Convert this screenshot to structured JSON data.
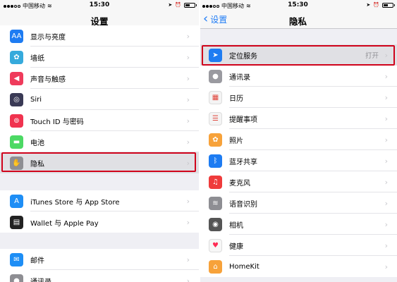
{
  "left": {
    "status": {
      "carrier": "中国移动",
      "time": "15:30"
    },
    "nav": {
      "title": "设置"
    },
    "group1": [
      {
        "label": "显示与亮度",
        "icon": "display-brightness-icon",
        "color": "#1e7cf2",
        "glyph": "AA"
      },
      {
        "label": "墙纸",
        "icon": "wallpaper-icon",
        "color": "#36aadc",
        "glyph": "✿"
      },
      {
        "label": "声音与触感",
        "icon": "sound-icon",
        "color": "#ef3b5b",
        "glyph": "◀"
      },
      {
        "label": "Siri",
        "icon": "siri-icon",
        "color": "#3a3a55",
        "glyph": "◎"
      },
      {
        "label": "Touch ID 与密码",
        "icon": "touch-id-icon",
        "color": "#f0334f",
        "glyph": "⊚"
      },
      {
        "label": "电池",
        "icon": "battery-icon",
        "color": "#4cd964",
        "glyph": "▬"
      },
      {
        "label": "隐私",
        "icon": "privacy-hand-icon",
        "color": "#8e8e93",
        "glyph": "✋"
      }
    ],
    "group2": [
      {
        "label": "iTunes Store 与 App Store",
        "icon": "app-store-icon",
        "color": "#1e8ef5",
        "glyph": "A"
      },
      {
        "label": "Wallet 与 Apple Pay",
        "icon": "wallet-icon",
        "color": "#222222",
        "glyph": "▤"
      }
    ],
    "group3": [
      {
        "label": "邮件",
        "icon": "mail-icon",
        "color": "#1e8ef5",
        "glyph": "✉"
      },
      {
        "label": "通讯录",
        "icon": "contacts-icon",
        "color": "#8e8e93",
        "glyph": "●"
      }
    ]
  },
  "right": {
    "status": {
      "carrier": "中国移动",
      "time": "15:30"
    },
    "nav": {
      "title": "隐私",
      "back": "设置"
    },
    "group1": [
      {
        "label": "定位服务",
        "detail": "打开",
        "icon": "location-arrow-icon",
        "color": "#1e7cf2",
        "glyph": "➤"
      },
      {
        "label": "通讯录",
        "icon": "contacts-icon",
        "color": "#9a9aa0",
        "glyph": "●"
      },
      {
        "label": "日历",
        "icon": "calendar-icon",
        "color": "#f4f4f4",
        "glyph": "▦"
      },
      {
        "label": "提醒事项",
        "icon": "reminders-icon",
        "color": "#f4f4f4",
        "glyph": "☰"
      },
      {
        "label": "照片",
        "icon": "photos-icon",
        "color": "#f7a23a",
        "glyph": "✿"
      },
      {
        "label": "蓝牙共享",
        "icon": "bluetooth-icon",
        "color": "#1e7cf2",
        "glyph": "ᛒ"
      },
      {
        "label": "麦克风",
        "icon": "microphone-icon",
        "color": "#ef3b3b",
        "glyph": "♫"
      },
      {
        "label": "语音识别",
        "icon": "speech-recognition-icon",
        "color": "#8e8e93",
        "glyph": "≋"
      },
      {
        "label": "相机",
        "icon": "camera-icon",
        "color": "#555555",
        "glyph": "◉"
      },
      {
        "label": "健康",
        "icon": "health-icon",
        "color": "#f7f7f7",
        "glyph": "♥"
      },
      {
        "label": "HomeKit",
        "icon": "homekit-icon",
        "color": "#f7a23a",
        "glyph": "⌂"
      }
    ]
  },
  "colors": {
    "accent": "#1f7cf6",
    "highlight_box": "#d0021b"
  }
}
